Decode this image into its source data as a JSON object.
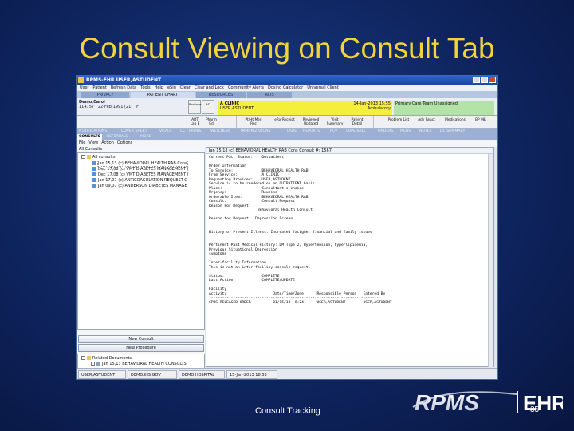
{
  "slide": {
    "title": "Consult Viewing on Consult Tab",
    "footer": "Consult Tracking",
    "page_number": "35",
    "logo_text": "RPMS EHR",
    "colors": {
      "title": "#f2d43a",
      "background": "#0f2560"
    }
  },
  "window": {
    "title": "RPMS-EHR USER,ASTUDENT",
    "menu": [
      "User",
      "Patient",
      "Refresh Data",
      "Tools",
      "Help",
      "eSig",
      "Clear",
      "Clear and Lock",
      "Community Alerts",
      "Dosing Calculator",
      "Universal Client"
    ],
    "top_tabs": [
      "PRIVACY",
      "PATIENT CHART",
      "RESOURCES",
      "RCIS"
    ],
    "active_top_tab": "PATIENT CHART",
    "patient": {
      "name": "Demo,Carol",
      "id": "114757",
      "dob": "22-Feb-1991 (21)",
      "sex": "F"
    },
    "small_buttons": [
      "Postings",
      "AD"
    ],
    "clinic": {
      "name": "A CLINIC",
      "user": "USER,ASTUDENT",
      "date": "14-Jan-2013 15:55",
      "type": "Ambulatory"
    },
    "provider": {
      "label": "Primary Care Team Unassigned"
    },
    "toolbar": [
      "ADT Lab E",
      "Pharm Ed",
      "Pt/Ht Med Rec",
      "eRx Receipt",
      "Reviewed Updated",
      "Visit Summary",
      "Patient Detail",
      "Problem List",
      "Adv React",
      "Medications",
      "BP 98/"
    ],
    "tabs": [
      "NOTIFICATIONS",
      "COVER SHEET",
      "VITALS",
      "CC / PROBS",
      "WELLNESS",
      "IMMUNIZATIONS",
      "LABS",
      "REPORTS",
      "PCV",
      "SUPERBILL",
      "ORDERS",
      "MEDS",
      "NOTES",
      "DC SUMMARY",
      "CONSULTS",
      "REFERRALS",
      "MORE"
    ],
    "active_tab": "CONSULTS",
    "view_menu": [
      "File",
      "View",
      "Action",
      "Options"
    ]
  },
  "left": {
    "header": "All Consults",
    "root": "All consults",
    "items": [
      "Jan 15,13  (c)  BEHAVIORAL HEALTH RAB Cons",
      "Dec 17,08  (c)  VMT DIABETES MANAGEMENT (",
      "Dec 17,08  (c)  VMT DIABETES MANAGEMENT (",
      "Jan 17,07  (c)  ANTICOAGULATION REQUEST C",
      "Jan 09,07  (c)  ANDERSON DIABETES MANAGE"
    ],
    "new_consult": "New Consult",
    "new_procedure": "New Procedure",
    "related_root": "Related Documents",
    "related_item": "Jan 15,13  BEHAVIORAL HEALTH CONSULTS"
  },
  "right": {
    "header": "Jan 15,13     (c)     BEHAVIORAL HEALTH RAB Cons                    Consult #: 1567",
    "lines": [
      "Current Pat. Status:    Outpatient",
      "",
      "Order Information",
      "To Service:             BEHAVIORAL HEALTH RAB",
      "From Service:           A CLINIC",
      "Requesting Provider:    USER,ASTUDENT",
      "Service is to be rendered on an OUTPATIENT basis",
      "Place:                  Consultant's choice",
      "Urgency:                Routine",
      "Orderable Item:         BEHAVIORAL HEALTH RAB",
      "Consult:                Consult Request",
      "Reason For Request:",
      "                      Behavioral Health Consult",
      "",
      "Reason for Request:  Depression Screen",
      "",
      "",
      "History of Present Illness: Increased fatigue, financial and family issues",
      "",
      "",
      "Pertinent Past Medical History: DM Type 2, Hypertension, hyperlipidemia,",
      "Previous Situational Depression",
      "symptoms",
      "",
      "Inter-facility Information",
      "This is not an inter-facility consult request.",
      "",
      "Status:                 COMPLETE",
      "Last Action:            COMPLETE/UPDATE",
      "",
      "Facility",
      "Activity                     Date/Time/Zone      Responsible Person   Entered By",
      "-----------------------------------------------------------------------------",
      "CPRS RELEASED ORDER          01/15/13  8:24      USER,ASTUDENT        USER,ASTUDENT"
    ]
  },
  "status": [
    "USER,ASTUDENT",
    "DEMO.IHS.GOV",
    "DEMO HOSPITAL",
    "15-Jan-2013 18:53"
  ]
}
